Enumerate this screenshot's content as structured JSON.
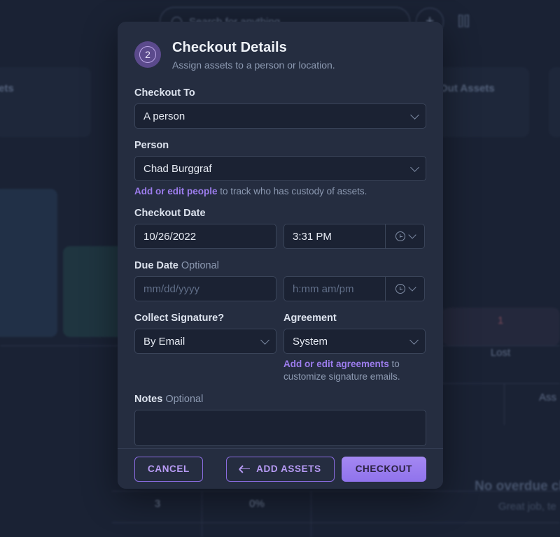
{
  "background": {
    "search_placeholder": "Search for anything",
    "add_icon": "plus-icon",
    "scan_icon": "barcode-scan-icon",
    "card_left_label": "ets",
    "card_right_label": "Out Assets",
    "stats": [
      {
        "value": "1",
        "label": "Lost"
      },
      {
        "value": "3",
        "label": ""
      },
      {
        "value": "0%",
        "label": ""
      }
    ],
    "table_header": "Ass",
    "empty_title": "No overdue ch",
    "empty_sub": "Great job, te"
  },
  "modal": {
    "step_badge": "2",
    "title": "Checkout Details",
    "subtitle": "Assign assets to a person or location.",
    "fields": {
      "checkout_to_label": "Checkout To",
      "checkout_to_value": "A person",
      "person_label": "Person",
      "person_value": "Chad Burggraf",
      "person_helper_link": "Add or edit people",
      "person_helper_text": " to track who has custody of assets.",
      "checkout_date_label": "Checkout Date",
      "checkout_date_value": "10/26/2022",
      "checkout_time_value": "3:31 PM",
      "due_date_label": "Due Date",
      "due_date_optional": "Optional",
      "due_date_placeholder": "mm/dd/yyyy",
      "due_time_placeholder": "h:mm am/pm",
      "collect_signature_label": "Collect Signature?",
      "collect_signature_value": "By Email",
      "agreement_label": "Agreement",
      "agreement_value": "System",
      "agreement_helper_link": "Add or edit agreements",
      "agreement_helper_text": " to customize signature emails.",
      "notes_label": "Notes",
      "notes_optional": "Optional",
      "notes_value": ""
    },
    "footer": {
      "cancel": "CANCEL",
      "add_assets": "ADD ASSETS",
      "checkout": "CHECKOUT"
    }
  },
  "colors": {
    "accent": "#9d7dee",
    "primary_button": "#9b7aee",
    "modal_bg": "#252d40",
    "input_bg": "#1b2233",
    "page_bg": "#1a2234"
  }
}
